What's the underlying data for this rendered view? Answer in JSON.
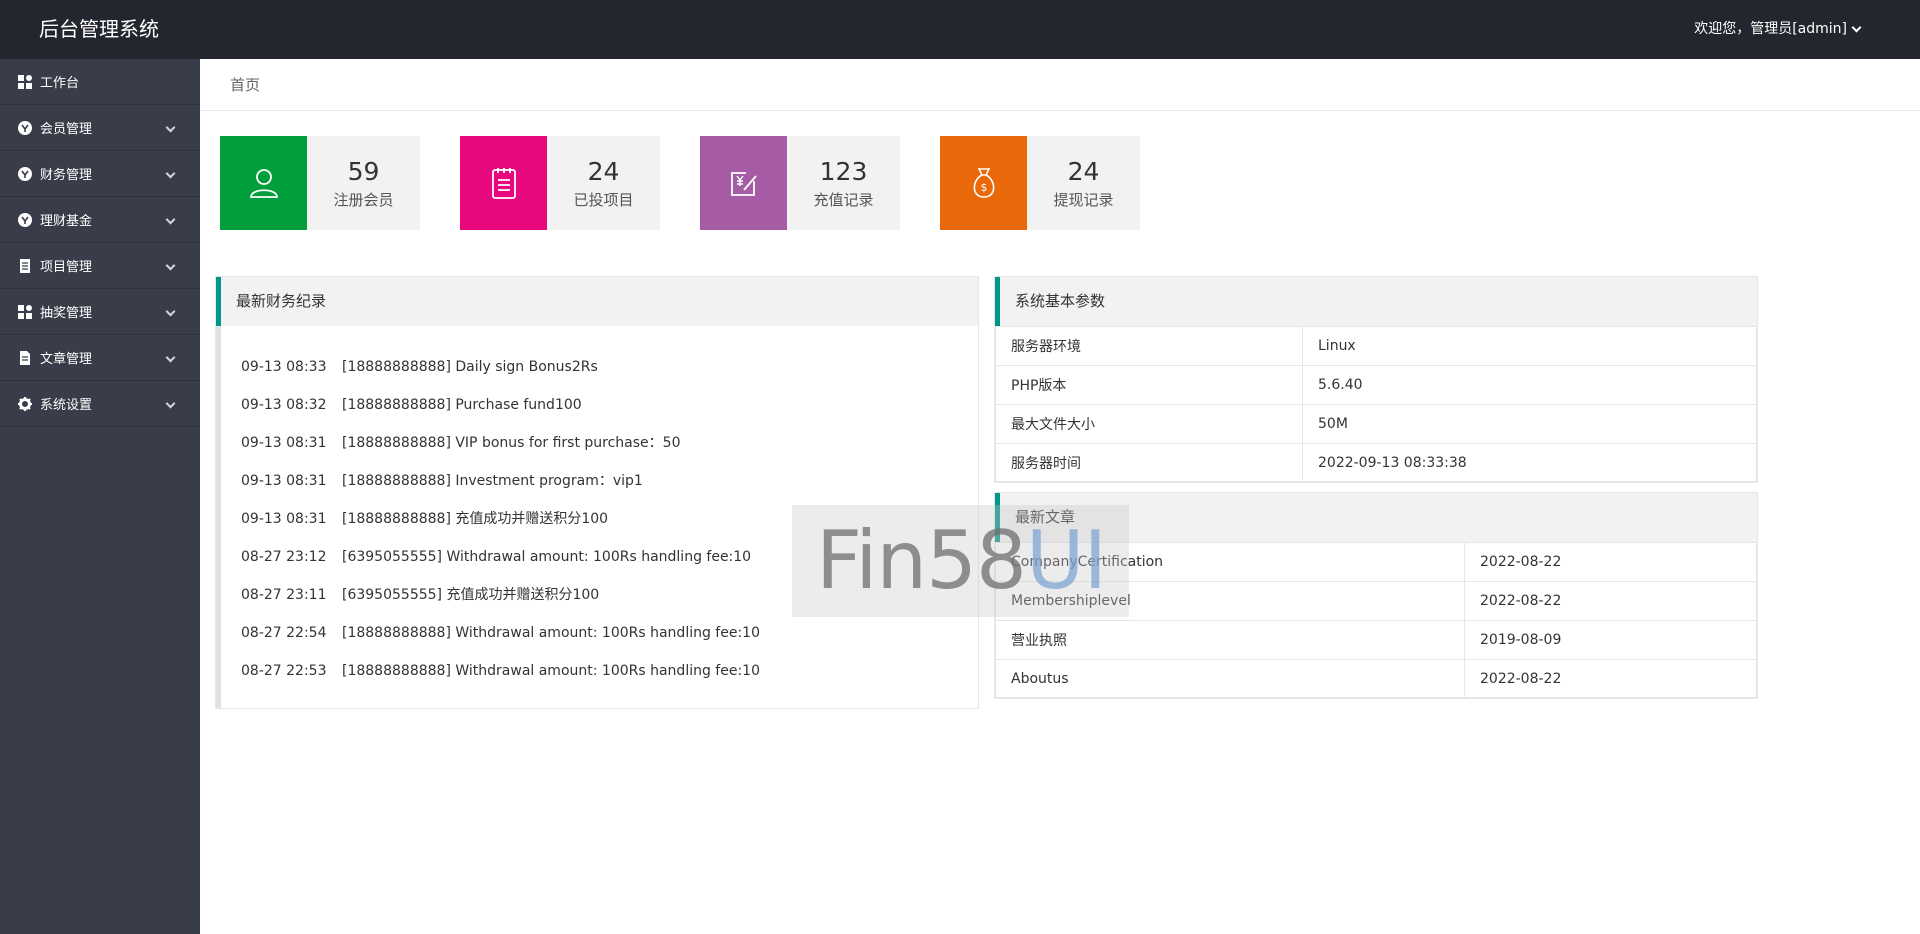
{
  "header": {
    "title": "后台管理系统",
    "user": "欢迎您，管理员[admin]"
  },
  "sidebar": {
    "items": [
      {
        "label": "工作台",
        "icon": "dashboard-icon"
      },
      {
        "label": "会员管理",
        "icon": "member-icon"
      },
      {
        "label": "财务管理",
        "icon": "finance-icon"
      },
      {
        "label": "理财基金",
        "icon": "fund-icon"
      },
      {
        "label": "项目管理",
        "icon": "project-icon"
      },
      {
        "label": "抽奖管理",
        "icon": "lottery-icon"
      },
      {
        "label": "文章管理",
        "icon": "article-icon"
      },
      {
        "label": "系统设置",
        "icon": "gear-icon"
      }
    ]
  },
  "breadcrumb": "首页",
  "stats": [
    {
      "value": "59",
      "label": "注册会员",
      "color": "#009f3c",
      "icon": "user-icon"
    },
    {
      "value": "24",
      "label": "已投项目",
      "color": "#e8087e",
      "icon": "clipboard-icon"
    },
    {
      "value": "123",
      "label": "充值记录",
      "color": "#a55ca5",
      "icon": "recharge-icon"
    },
    {
      "value": "24",
      "label": "提现记录",
      "color": "#e8680a",
      "icon": "money-bag-icon"
    }
  ],
  "finance": {
    "title": "最新财务纪录",
    "records": [
      {
        "time": "09-13 08:33",
        "text": "[18888888888] Daily sign Bonus2Rs"
      },
      {
        "time": "09-13 08:32",
        "text": "[18888888888] Purchase fund100"
      },
      {
        "time": "09-13 08:31",
        "text": "[18888888888] VIP bonus for first purchase：50"
      },
      {
        "time": "09-13 08:31",
        "text": "[18888888888] Investment program：vip1"
      },
      {
        "time": "09-13 08:31",
        "text": "[18888888888] 充值成功并赠送积分100"
      },
      {
        "time": "08-27 23:12",
        "text": "[6395055555] Withdrawal amount: 100Rs handling fee:10"
      },
      {
        "time": "08-27 23:11",
        "text": "[6395055555] 充值成功并赠送积分100"
      },
      {
        "time": "08-27 22:54",
        "text": "[18888888888] Withdrawal amount: 100Rs handling fee:10"
      },
      {
        "time": "08-27 22:53",
        "text": "[18888888888] Withdrawal amount: 100Rs handling fee:10"
      }
    ]
  },
  "system": {
    "title": "系统基本参数",
    "rows": [
      {
        "key": "服务器环境",
        "value": "Linux"
      },
      {
        "key": "PHP版本",
        "value": "5.6.40"
      },
      {
        "key": "最大文件大小",
        "value": "50M"
      },
      {
        "key": "服务器时间",
        "value": "2022-09-13 08:33:38"
      }
    ]
  },
  "articles": {
    "title": "最新文章",
    "rows": [
      {
        "title": "CompanyCertification",
        "date": "2022-08-22"
      },
      {
        "title": "Membershiplevel",
        "date": "2022-08-22"
      },
      {
        "title": "营业执照",
        "date": "2019-08-09"
      },
      {
        "title": "Aboutus",
        "date": "2022-08-22"
      }
    ]
  },
  "watermark": {
    "part1": "Fin58",
    "part2": "UI"
  }
}
